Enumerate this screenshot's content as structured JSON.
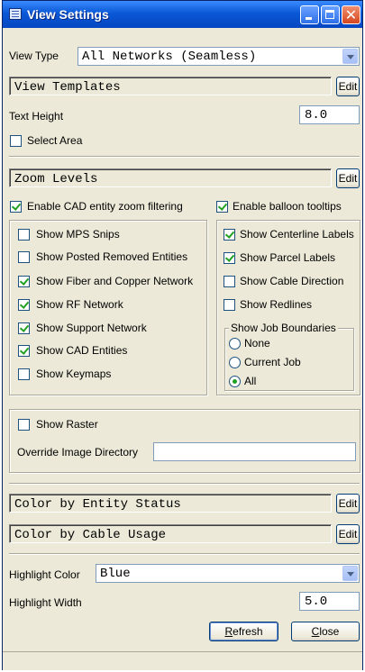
{
  "window": {
    "title": "View Settings"
  },
  "titlebar": {
    "close_glyph": "✕"
  },
  "view_type": {
    "label": "View Type",
    "value": "All Networks (Seamless)"
  },
  "view_templates": {
    "value": "View Templates",
    "edit_label": "Edit"
  },
  "text_height": {
    "label": "Text Height",
    "value": "8.0"
  },
  "select_area": {
    "label": "Select Area",
    "checked": false
  },
  "zoom_levels": {
    "value": "Zoom Levels",
    "edit_label": "Edit"
  },
  "enable_cad_zoom": {
    "label": "Enable CAD entity zoom filtering",
    "checked": true
  },
  "enable_balloon": {
    "label": "Enable balloon tooltips",
    "checked": true
  },
  "left_options": [
    {
      "label": "Show MPS Snips",
      "checked": false
    },
    {
      "label": "Show Posted Removed Entities",
      "checked": false
    },
    {
      "label": "Show Fiber and Copper Network",
      "checked": true
    },
    {
      "label": "Show RF Network",
      "checked": true
    },
    {
      "label": "Show Support Network",
      "checked": true
    },
    {
      "label": "Show CAD Entities",
      "checked": true
    },
    {
      "label": "Show Keymaps",
      "checked": false
    }
  ],
  "right_options": [
    {
      "label": "Show Centerline Labels",
      "checked": true
    },
    {
      "label": "Show Parcel Labels",
      "checked": true
    },
    {
      "label": "Show Cable Direction",
      "checked": false
    },
    {
      "label": "Show Redlines",
      "checked": false
    }
  ],
  "job_boundaries": {
    "title": "Show Job Boundaries",
    "options": [
      {
        "label": "None",
        "selected": false
      },
      {
        "label": "Current Job",
        "selected": false
      },
      {
        "label": "All",
        "selected": true
      }
    ]
  },
  "raster": {
    "show_label": "Show Raster",
    "checked": false,
    "override_label": "Override Image Directory",
    "override_value": ""
  },
  "color_by_entity": {
    "value": "Color by Entity Status",
    "edit_label": "Edit"
  },
  "color_by_cable": {
    "value": "Color by Cable Usage",
    "edit_label": "Edit"
  },
  "highlight_color": {
    "label": "Highlight Color",
    "value": "Blue"
  },
  "highlight_width": {
    "label": "Highlight Width",
    "value": "5.0"
  },
  "buttons": {
    "refresh_rest": "efresh",
    "refresh_key": "R",
    "close_rest": "lose",
    "close_key": "C"
  }
}
